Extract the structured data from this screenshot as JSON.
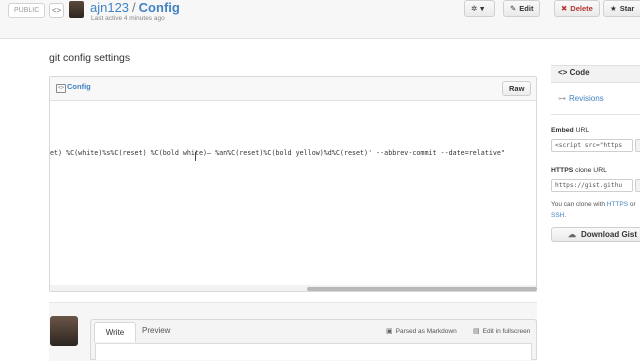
{
  "header": {
    "visibility_badge": "PUBLIC",
    "embed_toggle_icon": "<>",
    "owner": "ajn123",
    "separator": "/",
    "gist_name": "Config",
    "subtitle": "Last active 4 minutes ago",
    "gear_icon": "✲",
    "edit_label": "Edit",
    "edit_icon": "✎",
    "delete_label": "Delete",
    "delete_icon": "✖",
    "star_label": "Star",
    "star_icon": "★"
  },
  "main": {
    "description": "git config settings",
    "file": {
      "name": "Config",
      "raw_label": "Raw",
      "code_line": "et) %C(white)%s%C(reset) %C(bold white)— %an%C(reset)%C(bold yellow)%d%C(reset)' --abbrev-commit --date=relative\""
    }
  },
  "comment": {
    "tab_write": "Write",
    "tab_preview": "Preview",
    "markdown_note": "Parsed as Markdown",
    "fullscreen_note": "Edit in fullscreen"
  },
  "sidebar": {
    "code_label": "Code",
    "revisions_label": "Revisions",
    "embed_label": "Embed",
    "embed_suffix": "URL",
    "embed_value": "<script src=\"https",
    "https_label": "HTTPS",
    "https_suffix": "clone URL",
    "https_value": "https://gist.githu",
    "clone_note_prefix": "You can clone with",
    "clone_https": "HTTPS",
    "clone_or": "or",
    "clone_ssh": "SSH",
    "download_label": "Download Gist"
  },
  "colors": {
    "link": "#4183c4",
    "delete": "#b33630"
  }
}
